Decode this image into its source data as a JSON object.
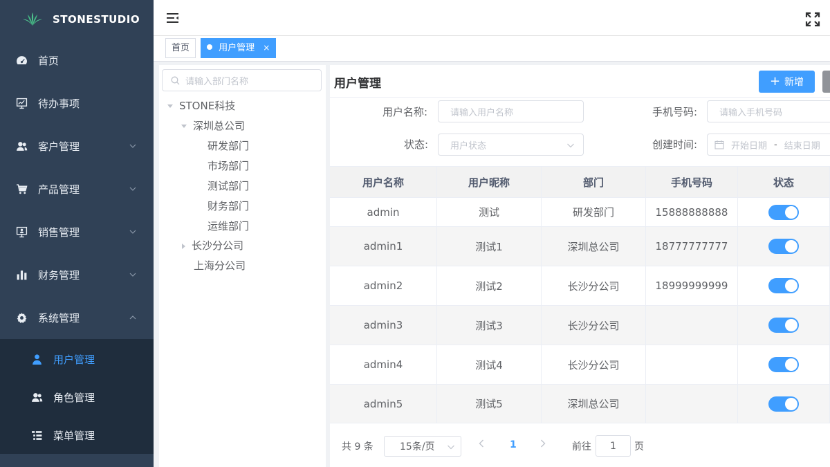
{
  "sidebar": {
    "logo_text": "STONESTUDIO",
    "items": [
      {
        "label": "首页",
        "icon": "dashboard-icon"
      },
      {
        "label": "待办事项",
        "icon": "chart-monitor-icon"
      },
      {
        "label": "客户管理",
        "icon": "users-icon"
      },
      {
        "label": "产品管理",
        "icon": "cart-icon"
      },
      {
        "label": "销售管理",
        "icon": "presentation-icon"
      },
      {
        "label": "财务管理",
        "icon": "bar-chart-icon"
      },
      {
        "label": "系统管理",
        "icon": "gear-icon"
      }
    ],
    "subitems": [
      {
        "label": "用户管理",
        "icon": "user-icon",
        "active": true
      },
      {
        "label": "角色管理",
        "icon": "users-icon"
      },
      {
        "label": "菜单管理",
        "icon": "menu-list-icon"
      }
    ]
  },
  "tags": [
    {
      "label": "首页"
    },
    {
      "label": "用户管理",
      "active": true,
      "close": "×"
    }
  ],
  "tree": {
    "search_placeholder": "请输入部门名称",
    "nodes": [
      "STONE科技",
      "深圳总公司",
      "研发部门",
      "市场部门",
      "测试部门",
      "财务部门",
      "运维部门",
      "长沙分公司",
      "上海分公司"
    ]
  },
  "main": {
    "title": "用户管理",
    "add_label": "新增",
    "form": {
      "username_label": "用户名称:",
      "username_placeholder": "请输入用户名称",
      "phone_label": "手机号码:",
      "phone_placeholder": "请输入手机号码",
      "status_label": "状态:",
      "status_placeholder": "用户状态",
      "created_label": "创建时间:",
      "date_start": "开始日期",
      "date_sep": "-",
      "date_end": "结束日期"
    },
    "table": {
      "headers": [
        "用户名称",
        "用户昵称",
        "部门",
        "手机号码",
        "状态"
      ],
      "rows": [
        {
          "username": "admin",
          "nickname": "测试",
          "dept": "研发部门",
          "phone": "15888888888",
          "enabled": true
        },
        {
          "username": "admin1",
          "nickname": "测试1",
          "dept": "深圳总公司",
          "phone": "18777777777",
          "enabled": true
        },
        {
          "username": "admin2",
          "nickname": "测试2",
          "dept": "长沙分公司",
          "phone": "18999999999",
          "enabled": true
        },
        {
          "username": "admin3",
          "nickname": "测试3",
          "dept": "长沙分公司",
          "phone": "",
          "enabled": true
        },
        {
          "username": "admin4",
          "nickname": "测试4",
          "dept": "长沙分公司",
          "phone": "",
          "enabled": true
        },
        {
          "username": "admin5",
          "nickname": "测试5",
          "dept": "深圳总公司",
          "phone": "",
          "enabled": true
        }
      ]
    },
    "pager": {
      "total": "共 9 条",
      "page_size": "15条/页",
      "current": "1",
      "goto_label": "前往",
      "goto_value": "1",
      "page_suffix": "页"
    }
  },
  "colors": {
    "accent": "#409eff",
    "sidebar_bg": "#304156",
    "submenu_bg": "#1f2d3d"
  }
}
